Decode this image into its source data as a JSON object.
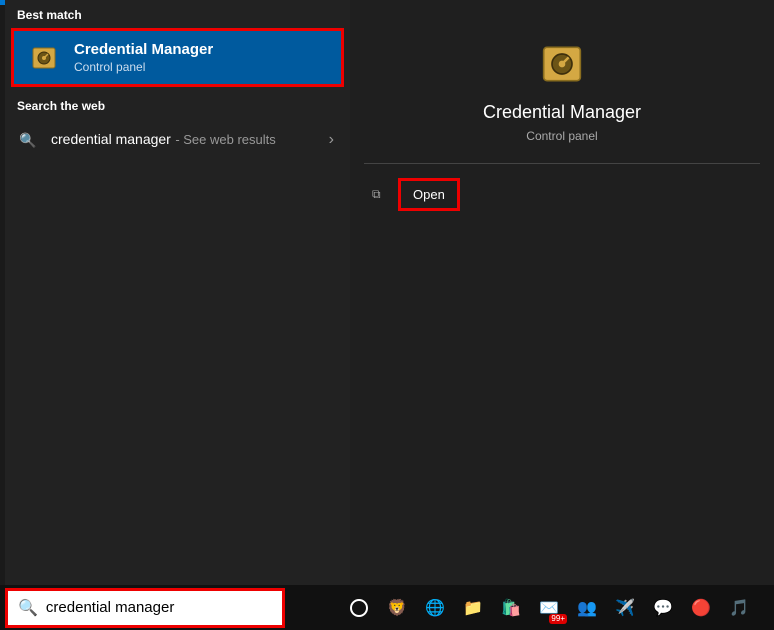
{
  "left": {
    "best_match_label": "Best match",
    "best_match": {
      "title": "Credential Manager",
      "subtitle": "Control panel"
    },
    "search_web_label": "Search the web",
    "web_result": {
      "query": "credential manager",
      "suffix": "- See web results"
    }
  },
  "right": {
    "title": "Credential Manager",
    "subtitle": "Control panel",
    "action_open": "Open"
  },
  "search": {
    "value": "credential manager"
  },
  "taskbar": {
    "badge99": "99+"
  }
}
